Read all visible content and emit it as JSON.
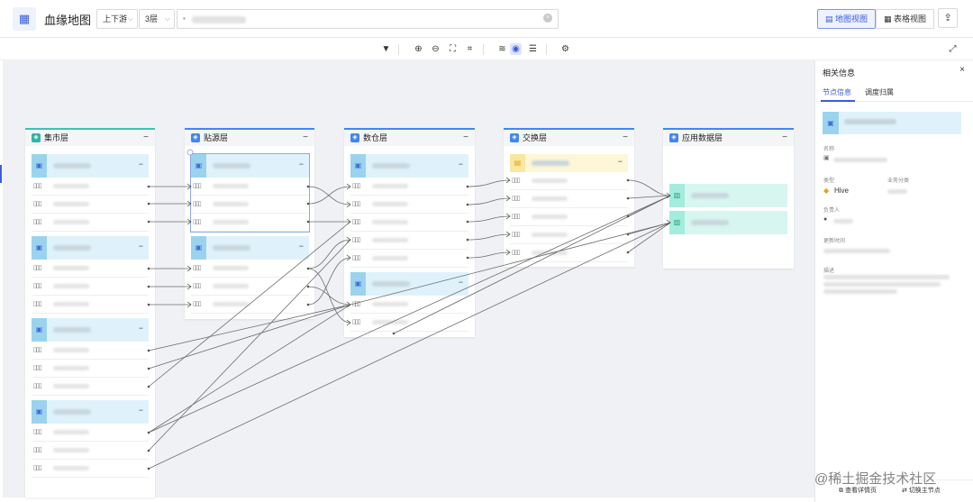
{
  "header": {
    "title": "血缘地图",
    "direction_select": "上下游",
    "level_select": "3层",
    "map_view_label": "地图视图",
    "table_view_label": "表格视图"
  },
  "layers": [
    {
      "title": "集市层"
    },
    {
      "title": "贴源层"
    },
    {
      "title": "数仓层"
    },
    {
      "title": "交换层"
    },
    {
      "title": "应用数据层"
    }
  ],
  "panel": {
    "title": "相关信息",
    "tabs": [
      "节点信息",
      "调度归属"
    ],
    "name_label": "名称",
    "type_label": "类型",
    "type_value": "Hive",
    "biz_label": "业务分类",
    "owner_label": "负责人",
    "updated_label": "更新时间",
    "desc_label": "描述",
    "detail_button": "查看详情页",
    "switch_button": "切换主节点"
  },
  "watermark": "@稀土掘金技术社区",
  "colors": {
    "accent": "#3b5bdb",
    "canvas_bg": "#eff1f4",
    "table_head": "#dff2fb",
    "exchange_head": "#fdf6d7",
    "app_head": "#d7f6ef"
  }
}
